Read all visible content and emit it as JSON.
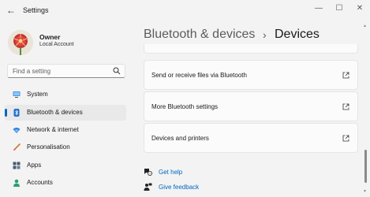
{
  "window": {
    "title": "Settings",
    "back_glyph": "←",
    "minimize_glyph": "—",
    "maximize_glyph": "☐",
    "close_glyph": "✕"
  },
  "user": {
    "name": "Owner",
    "account_type": "Local Account"
  },
  "search": {
    "placeholder": "Find a setting"
  },
  "nav": {
    "items": [
      {
        "label": "System",
        "icon": "monitor-icon"
      },
      {
        "label": "Bluetooth & devices",
        "icon": "bluetooth-icon",
        "selected": true
      },
      {
        "label": "Network & internet",
        "icon": "wifi-icon"
      },
      {
        "label": "Personalisation",
        "icon": "brush-icon"
      },
      {
        "label": "Apps",
        "icon": "apps-icon"
      },
      {
        "label": "Accounts",
        "icon": "person-icon"
      }
    ]
  },
  "breadcrumb": {
    "root": "Bluetooth & devices",
    "separator": "›",
    "current": "Devices"
  },
  "cards": [
    {
      "label": "Send or receive files via Bluetooth",
      "icon": "external-link-icon"
    },
    {
      "label": "More Bluetooth settings",
      "icon": "external-link-icon"
    },
    {
      "label": "Devices and printers",
      "icon": "external-link-icon"
    }
  ],
  "help": {
    "get_help": "Get help",
    "give_feedback": "Give feedback"
  },
  "colors": {
    "accent": "#0067c0",
    "background": "#f3f3f3",
    "card": "#fbfbfb"
  }
}
